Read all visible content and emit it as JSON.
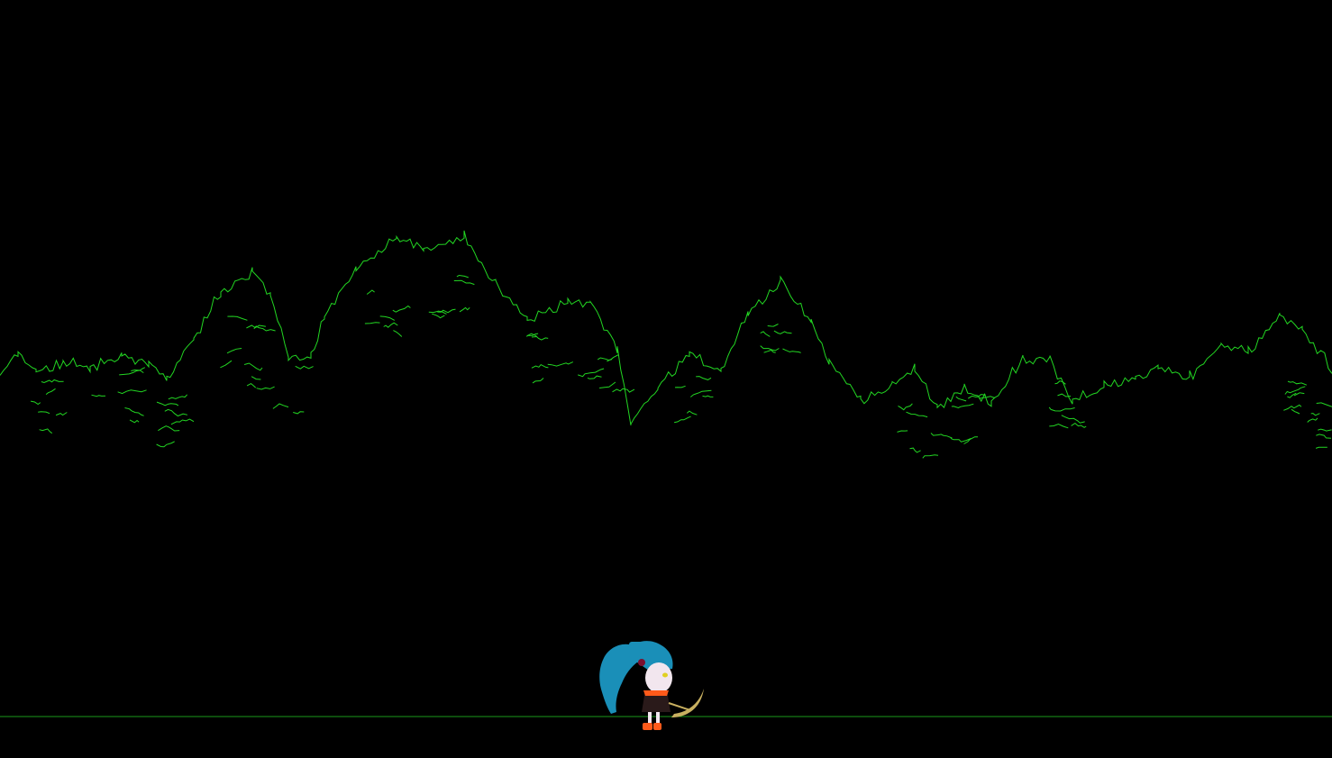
{
  "scene": {
    "background_color": "#000000",
    "outline_color": "#22d622",
    "ground_line_color": "#1a9a1a",
    "background_layer": "forest-treeline-outline",
    "player": {
      "icon": "player-character-sprite",
      "hair_color": "#1a8fb8",
      "skin_color": "#f2e6ee",
      "outfit_color": "#2a1a1a",
      "accent_color": "#ff5a1a",
      "weapon": "scythe",
      "weapon_color": "#c8b060"
    }
  }
}
